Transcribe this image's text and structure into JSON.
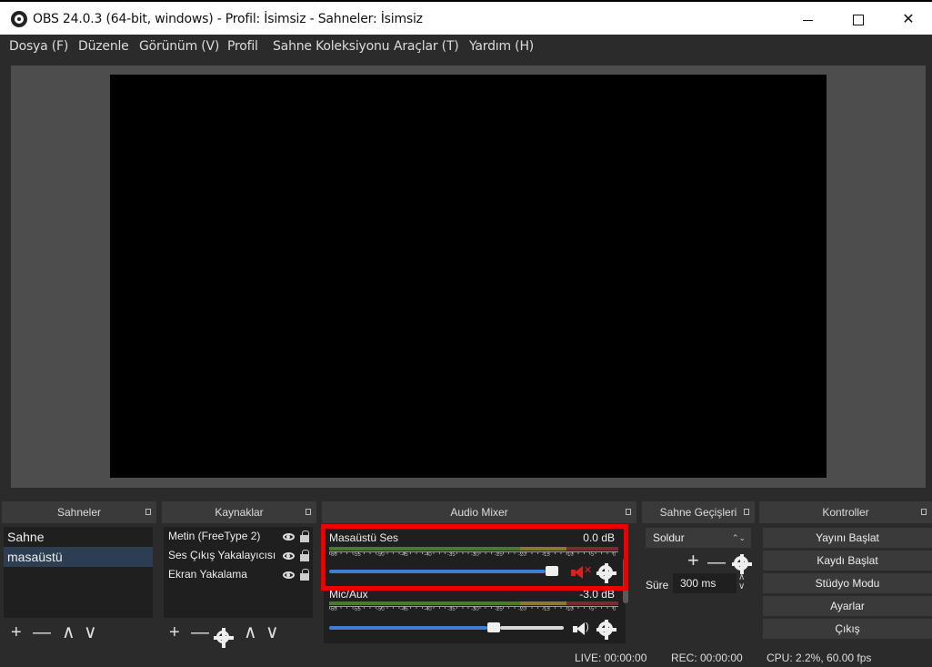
{
  "window": {
    "title": "OBS 24.0.3 (64-bit, windows) - Profil: İsimsiz - Sahneler: İsimsiz",
    "min_icon": "minimize-icon",
    "max_icon": "maximize-icon",
    "close_glyph": "✕"
  },
  "menu": {
    "items": [
      "Dosya (F)",
      "Düzenle",
      "Görünüm (V)",
      "Profil",
      "Sahne Koleksiyonu",
      "Araçlar (T)",
      "Yardım (H)"
    ]
  },
  "scenes": {
    "title": "Sahneler",
    "items": [
      "Sahne",
      "masaüstü"
    ],
    "selected": "masaüstü"
  },
  "sources": {
    "title": "Kaynaklar",
    "items": [
      "Metin (FreeType 2)",
      "Ses Çıkış Yakalayıcısı",
      "Ekran Yakalama"
    ]
  },
  "mixer": {
    "title": "Audio Mixer",
    "channels": [
      {
        "name": "Masaüstü Ses",
        "db": "0.0 dB",
        "volume": 1.0,
        "muted": true
      },
      {
        "name": "Mic/Aux",
        "db": "-3.0 dB",
        "volume": 0.73,
        "muted": false
      }
    ],
    "ticks": [
      "-60",
      "-55",
      "-50",
      "-45",
      "-40",
      "-35",
      "-30",
      "-25",
      "-20",
      "-15",
      "-10",
      "-5",
      "0"
    ]
  },
  "transitions": {
    "title": "Sahne Geçişleri",
    "selected": "Soldur",
    "duration_label": "Süre",
    "duration_value": "300 ms"
  },
  "controls": {
    "title": "Kontroller",
    "buttons": [
      "Yayını Başlat",
      "Kaydı Başlat",
      "Stüdyo Modu",
      "Ayarlar",
      "Çıkış"
    ]
  },
  "status": {
    "live": "LIVE: 00:00:00",
    "rec": "REC: 00:00:00",
    "cpu": "CPU: 2.2%, 60.00 fps"
  },
  "colors": {
    "accent": "#3e7fd3",
    "highlight": "#ee0000",
    "muted_icon": "#e02020"
  },
  "glyphs": {
    "plus": "+",
    "minus": "—",
    "up": "∧",
    "down": "∨",
    "combo_arrows": "⌃⌄"
  }
}
